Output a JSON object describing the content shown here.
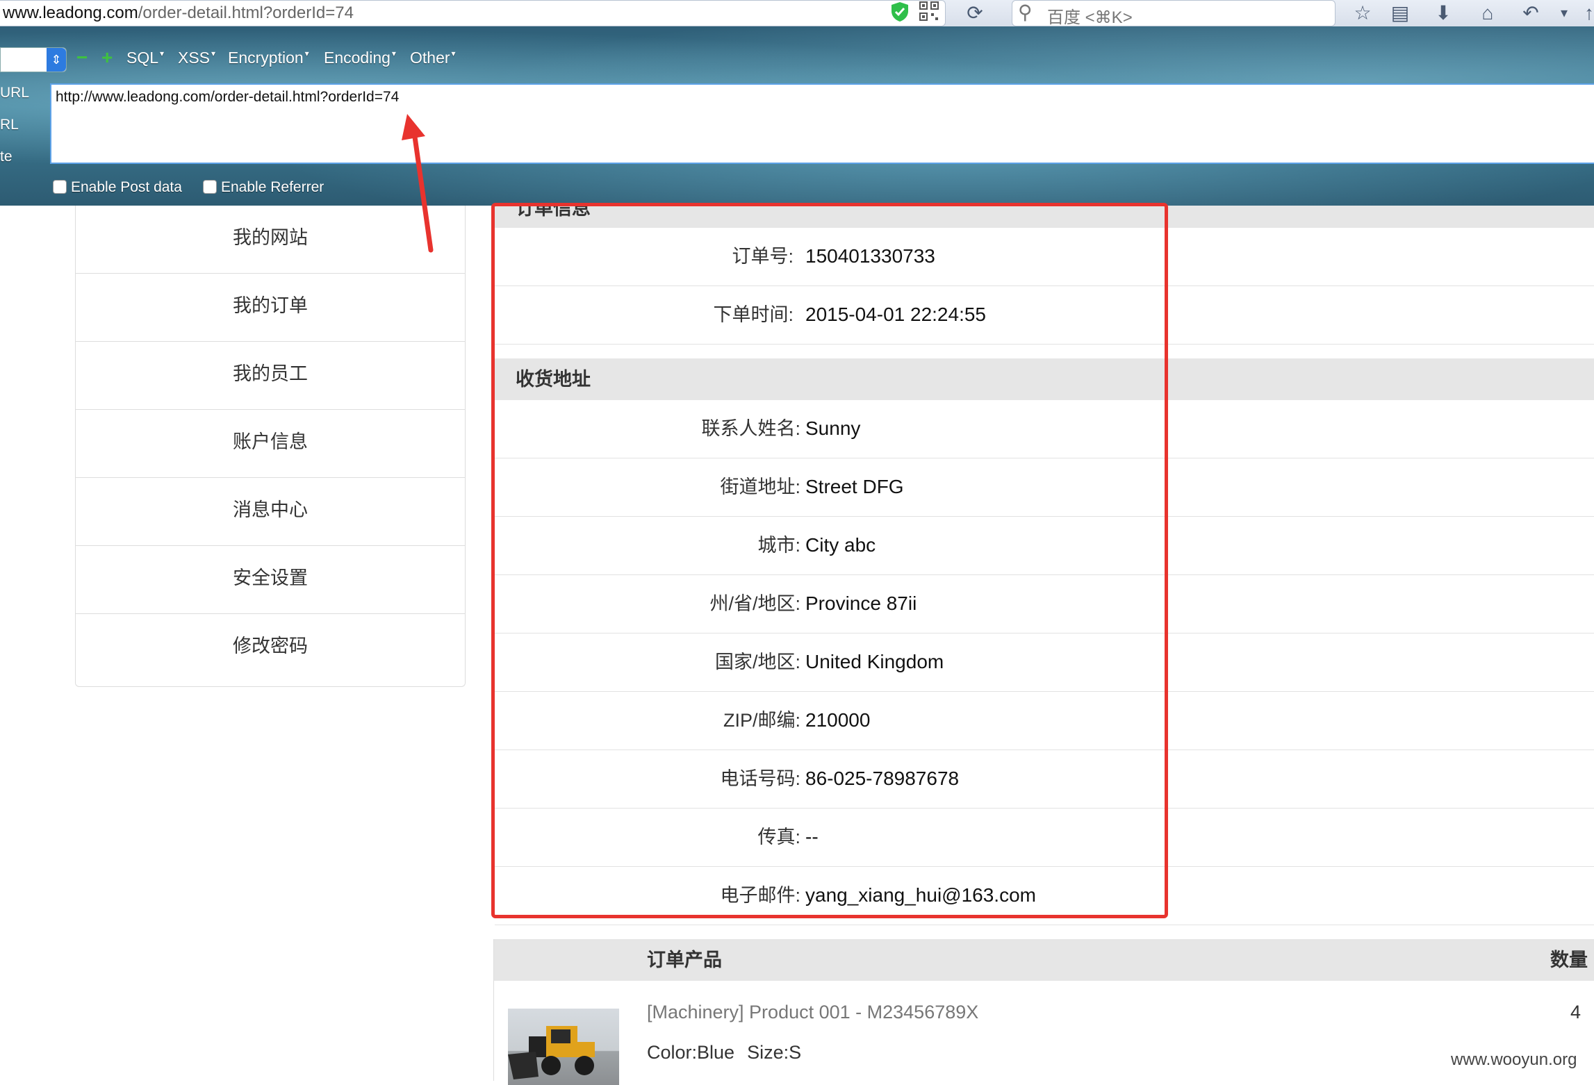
{
  "browser": {
    "url_host": "www.leadong.com",
    "url_path": "/order-detail.html?orderId=74",
    "search_placeholder": "百度 <⌘K>"
  },
  "hackbar": {
    "menus": [
      "SQL",
      "XSS",
      "Encryption",
      "Encoding",
      "Other"
    ],
    "side_labels": [
      "URL",
      "RL",
      "te"
    ],
    "url_value": "http://www.leadong.com/order-detail.html?orderId=74",
    "enable_post_label": "Enable Post data",
    "enable_referrer_label": "Enable Referrer"
  },
  "sidebar": {
    "items": [
      "我的网站",
      "我的订单",
      "我的员工",
      "账户信息",
      "消息中心",
      "安全设置",
      "修改密码"
    ]
  },
  "order_info": {
    "section_title": "订单信息",
    "rows": [
      {
        "label": "订单号:",
        "value": "150401330733"
      },
      {
        "label": "下单时间:",
        "value": "2015-04-01 22:24:55"
      }
    ]
  },
  "shipping": {
    "section_title": "收货地址",
    "rows": [
      {
        "label": "联系人姓名:",
        "value": "Sunny"
      },
      {
        "label": "街道地址:",
        "value": "Street DFG"
      },
      {
        "label": "城市:",
        "value": "City abc"
      },
      {
        "label": "州/省/地区:",
        "value": "Province 87ii"
      },
      {
        "label": "国家/地区:",
        "value": "United Kingdom"
      },
      {
        "label": "ZIP/邮编:",
        "value": "210000"
      },
      {
        "label": "电话号码:",
        "value": "86-025-78987678"
      },
      {
        "label": "传真:",
        "value": "--"
      },
      {
        "label": "电子邮件:",
        "value": "yang_xiang_hui@163.com"
      }
    ]
  },
  "products": {
    "header_title": "订单产品",
    "header_qty": "数量",
    "items": [
      {
        "name": "[Machinery] Product 001 - M23456789X",
        "color": "Color:Blue",
        "size": "Size:S",
        "qty": "4"
      }
    ]
  },
  "watermark": "www.wooyun.org",
  "colors": {
    "highlight": "#e8332e",
    "hackbar_accent": "#5da2e8"
  }
}
